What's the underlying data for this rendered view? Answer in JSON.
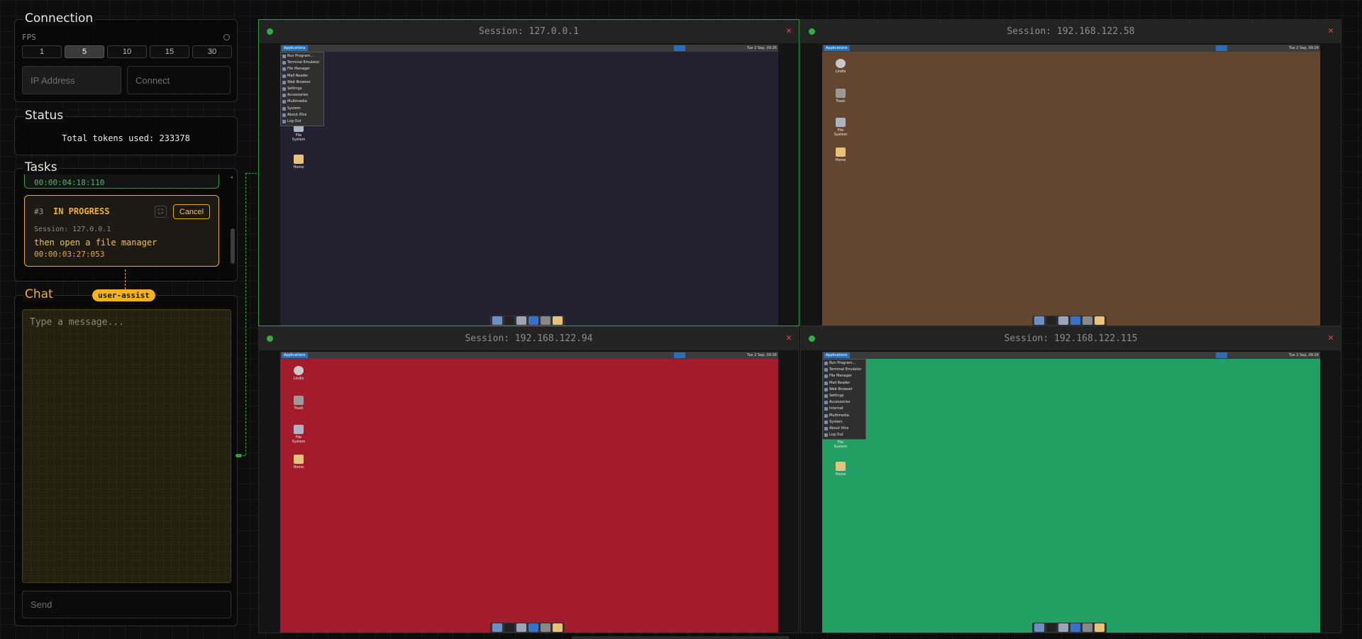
{
  "connection": {
    "title": "Connection",
    "fps_label": "FPS",
    "fps_options": [
      "1",
      "5",
      "10",
      "15",
      "30"
    ],
    "fps_selected": "5",
    "ip_placeholder": "IP Address",
    "connect_label": "Connect"
  },
  "status": {
    "title": "Status",
    "tokens_text": "Total tokens used: 233378"
  },
  "tasks": {
    "title": "Tasks",
    "previous_time": "00:00:04:18:110",
    "current": {
      "number": "#3",
      "status": "IN PROGRESS",
      "cancel_label": "Cancel",
      "session": "Session: 127.0.0.1",
      "description": "then open a file manager",
      "elapsed": "00:00:03:27:053"
    }
  },
  "chat": {
    "title": "Chat",
    "badge": "user-assist",
    "placeholder": "Type a message...",
    "send_label": "Send"
  },
  "sessions": [
    {
      "title": "Session: 127.0.0.1",
      "desktop_color": "#232030",
      "menu_open": true,
      "selected": true,
      "menu_items": [
        "Run Program...",
        "Terminal Emulator",
        "File Manager",
        "Mail Reader",
        "Web Browser",
        "Settings",
        "Accessories",
        "Multimedia",
        "System",
        "About Xfce",
        "Log Out"
      ],
      "icons": [
        "File System",
        "Home"
      ]
    },
    {
      "title": "Session: 192.168.122.58",
      "desktop_color": "#634630",
      "menu_open": false,
      "selected": false,
      "icons": [
        "Lindis",
        "Trash",
        "File System",
        "Home"
      ]
    },
    {
      "title": "Session: 192.168.122.94",
      "desktop_color": "#a21c2c",
      "menu_open": false,
      "selected": false,
      "icons": [
        "Lindis",
        "Trash",
        "File System",
        "Home"
      ]
    },
    {
      "title": "Session: 192.168.122.115",
      "desktop_color": "#22a064",
      "menu_open": true,
      "selected": false,
      "menu_items": [
        "Run Program...",
        "Terminal Emulator",
        "File Manager",
        "Mail Reader",
        "Web Browser",
        "Settings",
        "Accessories",
        "Internet",
        "Multimedia",
        "System",
        "About Xfce",
        "Log Out"
      ],
      "icons": [
        "File System",
        "Home"
      ]
    }
  ],
  "xfce": {
    "apps_label": "Applications",
    "clock": "Tue 2 Sep, 09:26"
  },
  "icons": {
    "session_close": "close-icon",
    "session_status": "status-dot-icon",
    "expand": "expand-icon"
  }
}
